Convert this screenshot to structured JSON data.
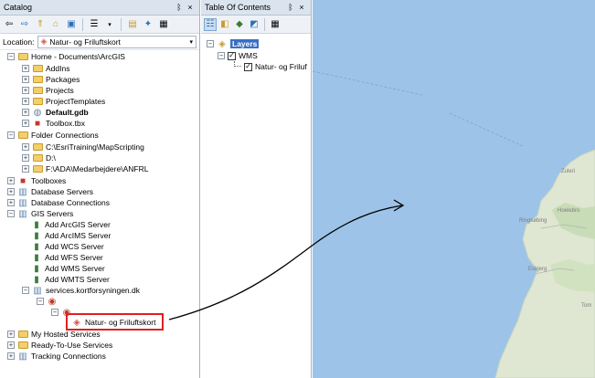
{
  "catalog": {
    "title": "Catalog",
    "pin": "ᛒ",
    "close": "×",
    "location_label": "Location:",
    "location_value": "Natur- og Friluftskort",
    "tree": [
      "Home - Documents\\ArcGIS",
      "AddIns",
      "Packages",
      "Projects",
      "ProjectTemplates",
      "Default.gdb",
      "Toolbox.tbx",
      "Folder Connections",
      "C:\\EsriTraining\\MapScripting",
      "D:\\",
      "F:\\ADA\\Medarbejdere\\ANFRL",
      "Toolboxes",
      "Database Servers",
      "Database Connections",
      "GIS Servers",
      "Add ArcGIS Server",
      "Add ArcIMS Server",
      "Add WCS Server",
      "Add WFS Server",
      "Add WMS Server",
      "Add WMTS Server",
      "services.kortforsyningen.dk",
      "Natur- og Friluftskort",
      "My Hosted Services",
      "Ready-To-Use Services",
      "Tracking Connections"
    ]
  },
  "toc": {
    "title": "Table Of Contents",
    "pin": "ᛒ",
    "close": "×",
    "layers": "Layers",
    "wms": "WMS",
    "layer": "Natur- og Friluf"
  },
  "map": {
    "place_labels": [
      "Zuleri",
      "Hoelebro",
      "Ringkøbing",
      "Esbjerg",
      "Tom"
    ]
  },
  "colors": {
    "highlight": "#e0201f",
    "water": "#9dc3e8",
    "land": "#dfe6d2"
  }
}
